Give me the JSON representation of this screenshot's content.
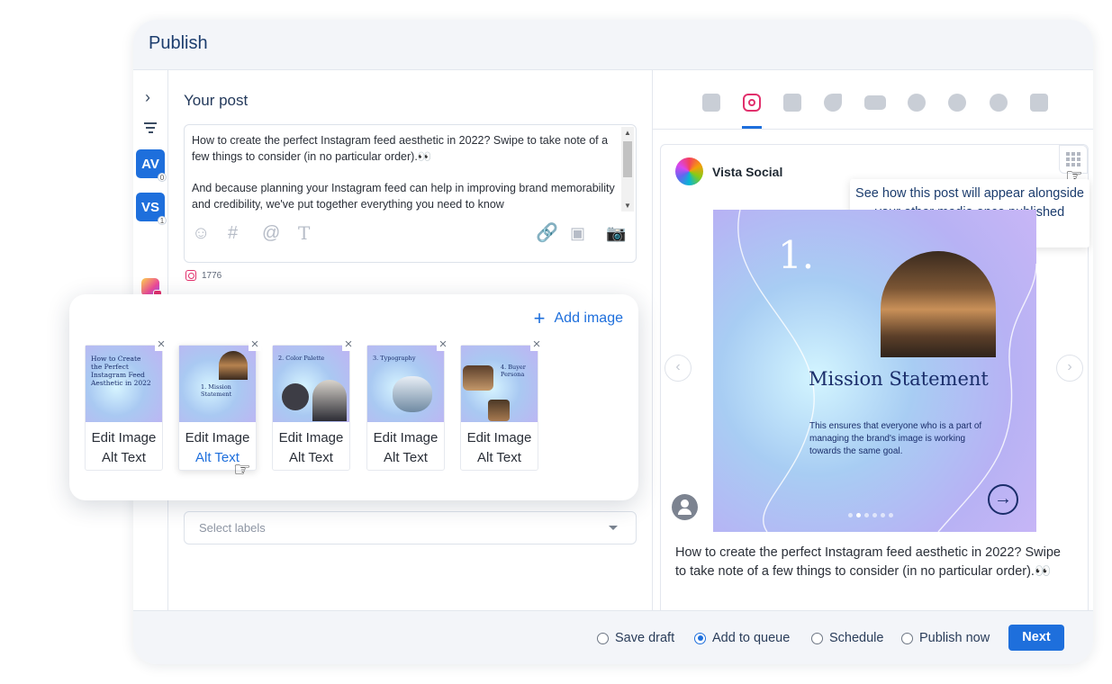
{
  "window": {
    "title": "Publish"
  },
  "composer": {
    "heading": "Your post",
    "text_p1": "How to create the perfect Instagram feed aesthetic in 2022? Swipe to take note of a few things to consider (in no particular order).👀",
    "text_p2": "And because planning your Instagram feed can help in improving brand memorability and credibility, we've put together everything you need to know",
    "instagram_count": "1776",
    "labels_placeholder": "Select labels"
  },
  "profiles": [
    {
      "initials": "AV",
      "count": "0"
    },
    {
      "initials": "VS",
      "count": "1"
    }
  ],
  "networks": [
    "facebook",
    "instagram",
    "linkedin",
    "twitter",
    "youtube",
    "google",
    "reddit",
    "pinterest",
    "tiktok"
  ],
  "preview": {
    "profile_name": "Vista Social",
    "tooltip": "See how this post will appear alongside your other media once published",
    "slide_number": "1.",
    "slide_title": "Mission Statement",
    "slide_body": "This ensures that everyone who is a part of managing the brand's image is working towards the same goal.",
    "caption": "How to create the perfect Instagram feed aesthetic in 2022? Swipe to take note of a few things to consider (in no particular order).👀"
  },
  "media": {
    "add_label": "Add image",
    "items": [
      {
        "line1": "Edit Image",
        "line2": "Alt Text",
        "thumb_text": "How to Create the Perfect Instagram Feed Aesthetic in 2022"
      },
      {
        "line1": "Edit Image",
        "line2": "Alt Text",
        "thumb_text": "1. Mission Statement"
      },
      {
        "line1": "Edit Image",
        "line2": "Alt Text",
        "thumb_text": "2. Color Palette"
      },
      {
        "line1": "Edit Image",
        "line2": "Alt Text",
        "thumb_text": "3. Typography"
      },
      {
        "line1": "Edit Image",
        "line2": "Alt Text",
        "thumb_text": "4. Buyer Persona"
      }
    ]
  },
  "footer": {
    "options": [
      "Save draft",
      "Add to queue",
      "Schedule",
      "Publish now"
    ],
    "selected": "Add to queue",
    "next_label": "Next"
  },
  "colors": {
    "accent": "#1e6fdc",
    "instagram": "#e1306c",
    "title": "#1c3d6e"
  }
}
